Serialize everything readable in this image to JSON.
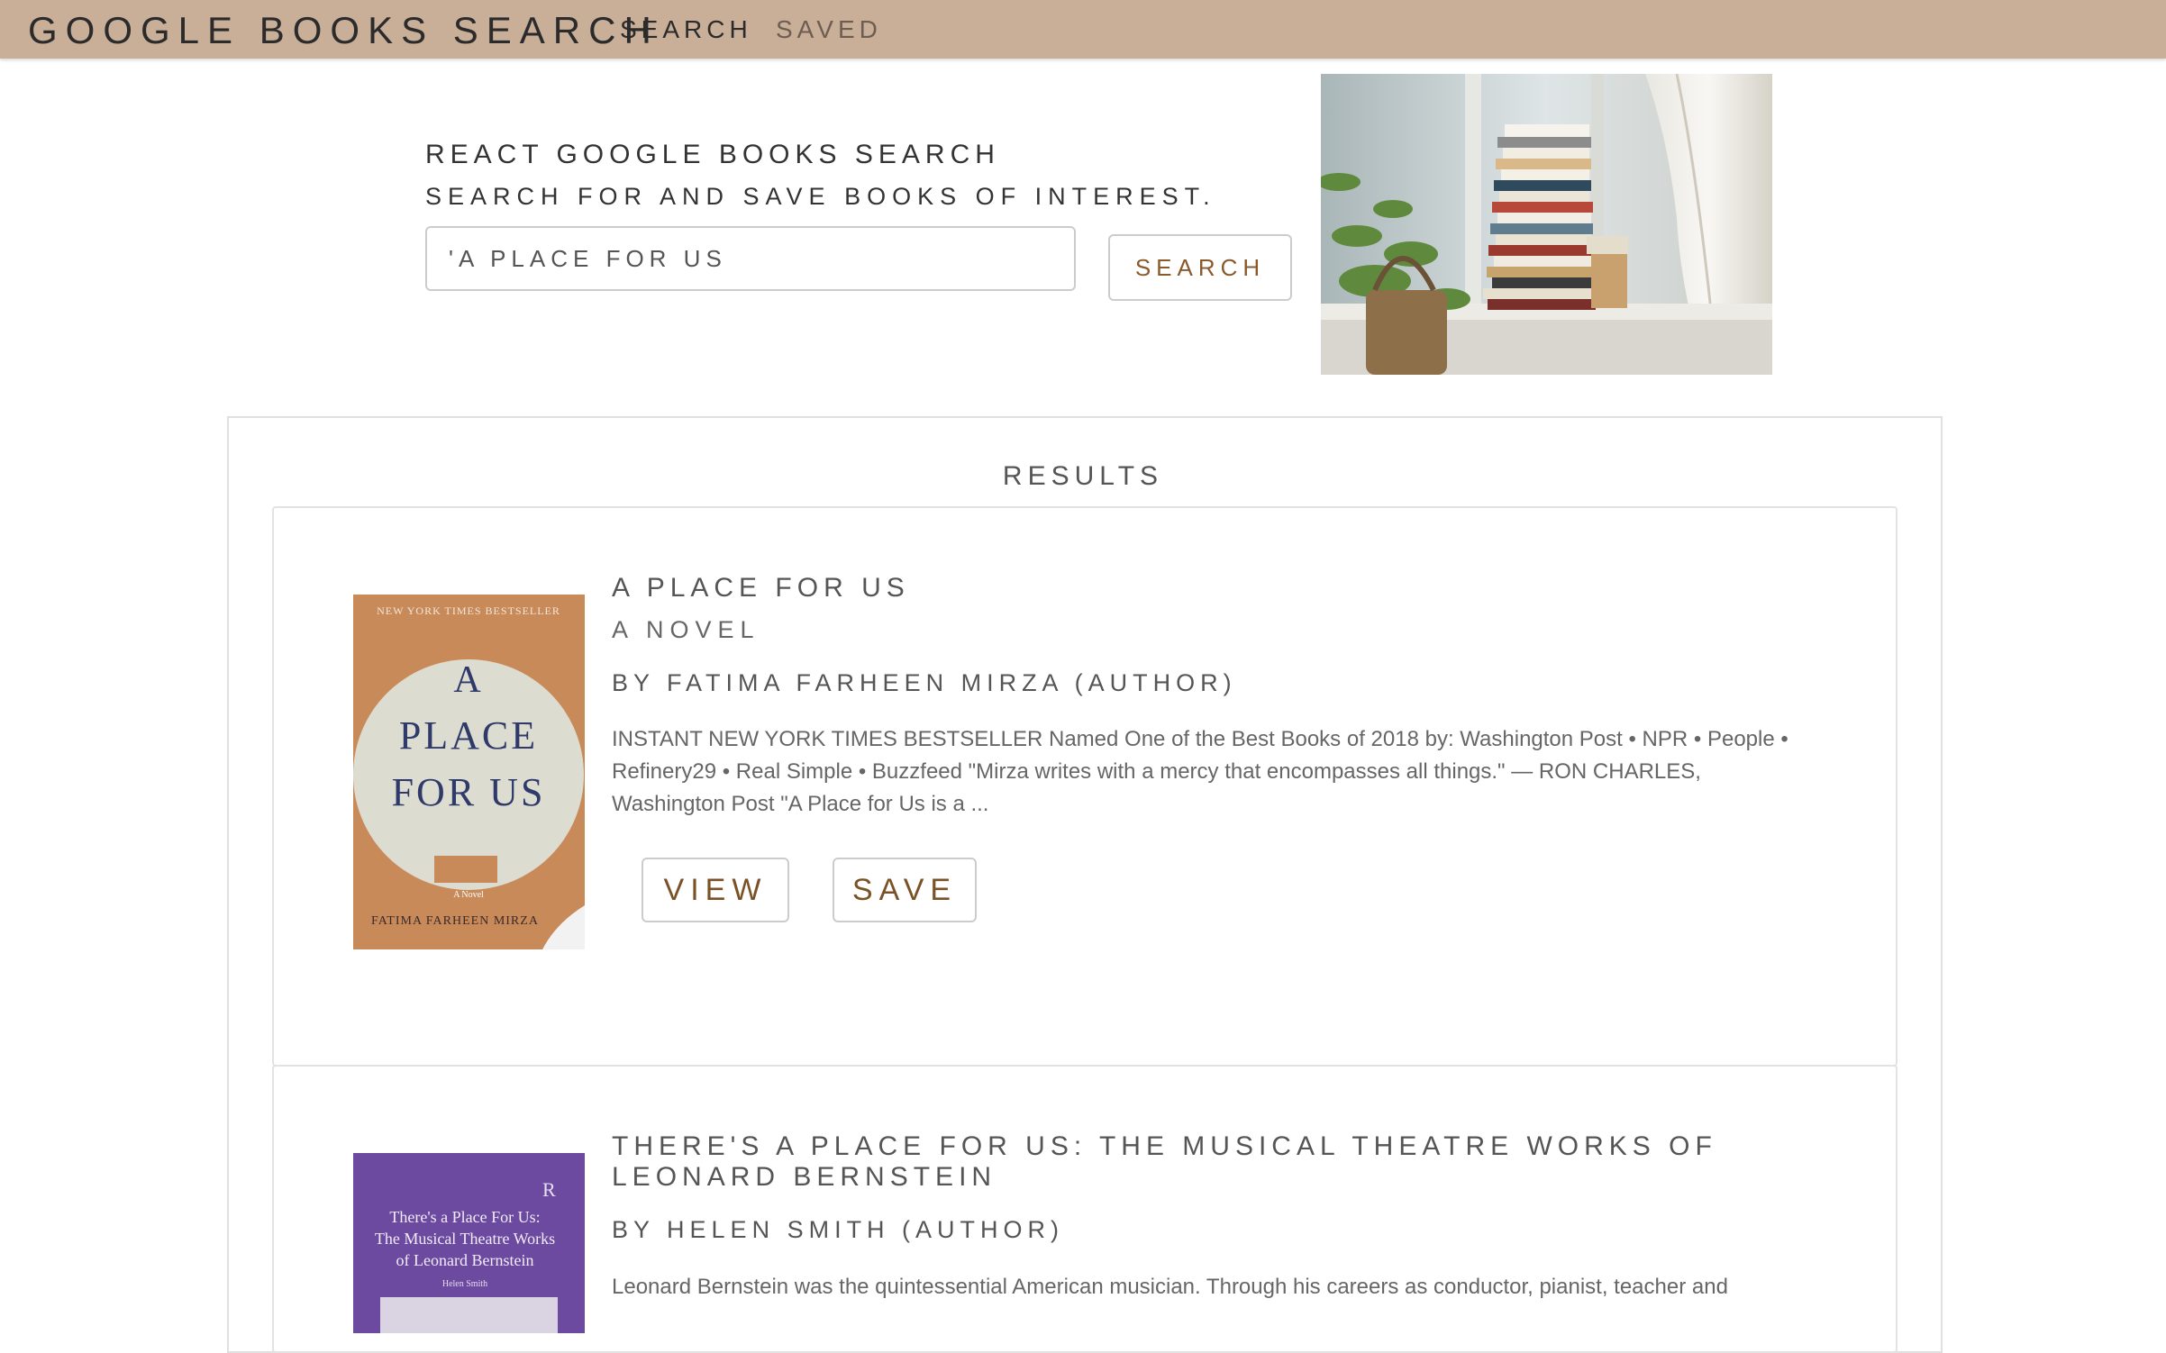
{
  "navbar": {
    "brand": "GOOGLE BOOKS SEARCH",
    "links": [
      {
        "label": "SEARCH",
        "active": true
      },
      {
        "label": "SAVED",
        "active": false
      }
    ],
    "background": "#c9ae98"
  },
  "hero": {
    "title": "REACT GOOGLE BOOKS SEARCH",
    "subtitle": "SEARCH FOR AND SAVE BOOKS OF INTEREST.",
    "search_value": "'A PLACE FOR US",
    "search_button": "SEARCH"
  },
  "results": {
    "heading": "RESULTS",
    "items": [
      {
        "title": "A PLACE FOR US",
        "subtitle": "A NOVEL",
        "author": "BY FATIMA FARHEEN MIRZA (AUTHOR)",
        "description": "INSTANT NEW YORK TIMES BESTSELLER Named One of the Best Books of 2018 by: Washington Post • NPR • People • Refinery29 • Real Simple • Buzzfeed \"Mirza writes with a mercy that encompasses all things.\" — RON CHARLES, Washington Post \"A Place for Us is a ...",
        "view_label": "VIEW",
        "save_label": "SAVE",
        "cover": {
          "top_text": "NEW YORK TIMES BESTSELLER",
          "title_lines": [
            "A",
            "PLACE",
            "FOR US"
          ],
          "tag": "A Novel",
          "author": "FATIMA FARHEEN MIRZA"
        }
      },
      {
        "title": "THERE'S A PLACE FOR US: THE MUSICAL THEATRE WORKS OF LEONARD BERNSTEIN",
        "author": "BY HELEN SMITH (AUTHOR)",
        "description": "Leonard Bernstein was the quintessential American musician. Through his careers as conductor, pianist, teacher and",
        "cover": {
          "logo": "R",
          "title_lines": [
            "There's a Place For Us:",
            "The Musical Theatre Works",
            "of Leonard Bernstein"
          ],
          "author": "Helen Smith"
        }
      }
    ]
  }
}
